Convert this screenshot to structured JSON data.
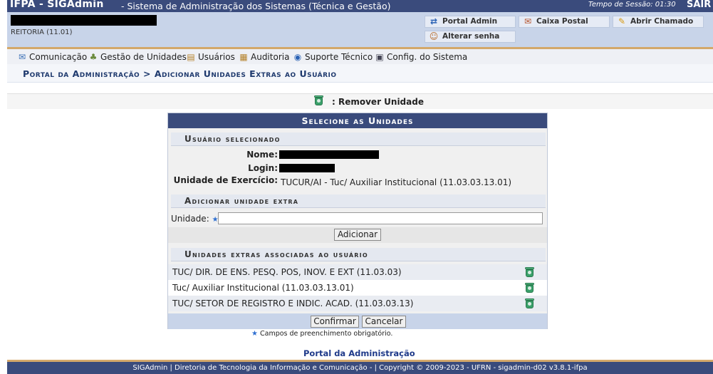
{
  "header": {
    "app_title": "IFPA - SIGAdmin",
    "subtitle": "- Sistema de Administração dos Sistemas (Técnica e Gestão)",
    "session": "Tempo de Sessão: 01:30",
    "logout": "SAIR",
    "unit": "REITORIA (11.01)",
    "buttons": {
      "portal_admin": "Portal Admin",
      "caixa_postal": "Caixa Postal",
      "abrir_chamado": "Abrir Chamado",
      "alterar_senha": "Alterar senha"
    }
  },
  "menu": {
    "items": [
      "Comunicação",
      "Gestão de Unidades",
      "Usuários",
      "Auditoria",
      "Suporte Técnico",
      "Config. do Sistema"
    ]
  },
  "breadcrumb": "Portal da Administração > Adicionar Unidades Extras ao Usuário",
  "legend": ": Remover Unidade",
  "form": {
    "title": "Selecione as Unidades",
    "section_user": "Usuário selecionado",
    "nome_label": "Nome:",
    "login_label": "Login:",
    "exercicio_label": "Unidade de Exercício:",
    "exercicio_value": "TUCUR/AI - Tuc/ Auxiliar Institucional (11.03.03.13.01)",
    "section_add": "Adicionar unidade extra",
    "unidade_label": "Unidade:",
    "unidade_value": "",
    "add_button": "Adicionar",
    "section_extras": "Unidades extras associadas ao usuário",
    "extras": [
      "TUC/ DIR. DE ENS. PESQ. POS, INOV. E EXT (11.03.03)",
      "Tuc/ Auxiliar Institucional (11.03.03.13.01)",
      "TUC/ SETOR DE REGISTRO E INDIC. ACAD. (11.03.03.13)"
    ],
    "confirm_button": "Confirmar",
    "cancel_button": "Cancelar"
  },
  "required_note": "Campos de preenchimento obrigatório.",
  "portal_link": "Portal da Administração",
  "footer": "SIGAdmin | Diretoria de Tecnologia da Informação e Comunicação - | Copyright © 2009-2023 - UFRN - sigadmin-d02 v3.8.1-ifpa",
  "colors": {
    "header_bg": "#3a4b7c",
    "info_bg": "#c8d4e9",
    "accent": "#d4a86a"
  }
}
